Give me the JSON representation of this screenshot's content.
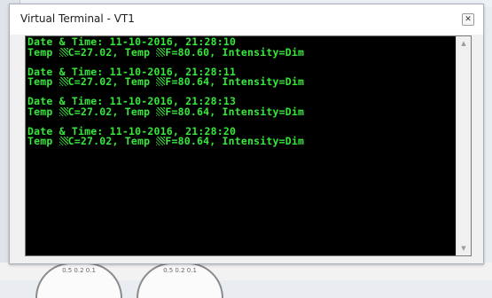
{
  "window": {
    "title": "Virtual Terminal - VT1",
    "close_glyph": "✕"
  },
  "terminal": {
    "text_color": "#35e83a",
    "background": "#000000",
    "entries": [
      {
        "date_line": "Date & Time: 11-10-2016, 21:28:10",
        "temp_c": "27.02",
        "temp_f": "80.60",
        "intensity": "Dim"
      },
      {
        "date_line": "Date & Time: 11-10-2016, 21:28:11",
        "temp_c": "27.02",
        "temp_f": "80.64",
        "intensity": "Dim"
      },
      {
        "date_line": "Date & Time: 11-10-2016, 21:28:13",
        "temp_c": "27.02",
        "temp_f": "80.64",
        "intensity": "Dim"
      },
      {
        "date_line": "Date & Time: 11-10-2016, 21:28:20",
        "temp_c": "27.02",
        "temp_f": "80.64",
        "intensity": "Dim"
      }
    ],
    "labels": {
      "temp": "Temp ",
      "c_suffix": "C=",
      "f_prefix": ", Temp ",
      "f_suffix": "F=",
      "intensity": ", Intensity="
    }
  },
  "scrollbar": {
    "up_icon": "▲",
    "down_icon": "▼"
  },
  "background": {
    "dial_ticks": "0.5 0.2 0.1"
  }
}
